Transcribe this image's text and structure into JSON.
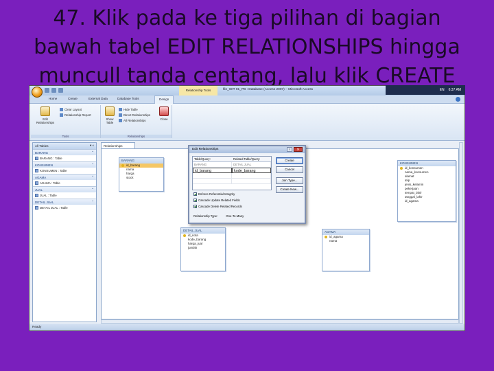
{
  "slide": {
    "title_lines": [
      "47. Klik pada ke tiga pilihan di bagian",
      "bawah tabel EDIT RELATIONSHIPS hingga",
      "muncull tanda centang, lalu klik CREATE"
    ]
  },
  "window": {
    "title": "file_WIT 01_PB : Database (Access 2007) – Microsoft Access",
    "context_tab": "Relationship Tools",
    "controls": [
      "–",
      "□",
      "✕"
    ]
  },
  "tray": {
    "lang": "EN",
    "time": "6:37 AM"
  },
  "ribbon": {
    "tabs": [
      "Home",
      "Create",
      "External Data",
      "Database Tools",
      "Design"
    ],
    "active_tab": "Design",
    "tools_group": {
      "label": "Tools",
      "edit_relationships": "Edit Relationships",
      "clear_layout": "Clear Layout",
      "relationship_report": "Relationship Report"
    },
    "relationships_group": {
      "label": "Relationships",
      "show_table": "Show Table",
      "hide_table": "Hide Table",
      "direct_relationships": "Direct Relationships",
      "all_relationships": "All Relationships",
      "close": "Close"
    }
  },
  "nav": {
    "header": "All Tables",
    "groups": [
      {
        "name": "BARANG",
        "item": "BARANG : Table"
      },
      {
        "name": "KONSUMEN",
        "item": "KONSUMEN : Table"
      },
      {
        "name": "AGAMA",
        "item": "AGAMA : Table"
      },
      {
        "name": "JUAL",
        "item": "JUAL : Table"
      },
      {
        "name": "DETAIL JUAL",
        "item": "DETAIL JUAL : Table"
      }
    ]
  },
  "doc_tab": "Relationships",
  "tables": {
    "barang": {
      "title": "BARANG",
      "fields": [
        "id_barang",
        "nama",
        "harga",
        "stock"
      ]
    },
    "konsumen": {
      "title": "KONSUMEN",
      "fields": [
        "id_konsumen",
        "nama_konsumen",
        "alamat",
        "telp",
        "jenis_kelamin",
        "pekerjaan",
        "tempat_lahir",
        "tanggal_lahir",
        "id_agama"
      ]
    },
    "detail_jual": {
      "title": "DETAIL JUAL",
      "fields": [
        "id_nota",
        "kode_barang",
        "harga_jual",
        "jumlah"
      ]
    },
    "agama": {
      "title": "AGAMA",
      "fields": [
        "id_agama",
        "nama"
      ]
    }
  },
  "dialog": {
    "title": "Edit Relationships",
    "col_table": "Table/Query:",
    "col_related": "Related Table/Query:",
    "table_value": "BARANG",
    "related_value": "DETAIL JUAL",
    "field_left": "id_barang",
    "field_right": "kode_barang",
    "checks": [
      {
        "label": "Enforce Referential Integrity",
        "checked": true
      },
      {
        "label": "Cascade Update Related Fields",
        "checked": true
      },
      {
        "label": "Cascade Delete Related Records",
        "checked": true
      }
    ],
    "rel_type_label": "Relationship Type:",
    "rel_type_value": "One-To-Many",
    "buttons": {
      "create": "Create",
      "cancel": "Cancel",
      "join_type": "Join Type...",
      "create_new": "Create New..."
    }
  },
  "status": "Ready"
}
